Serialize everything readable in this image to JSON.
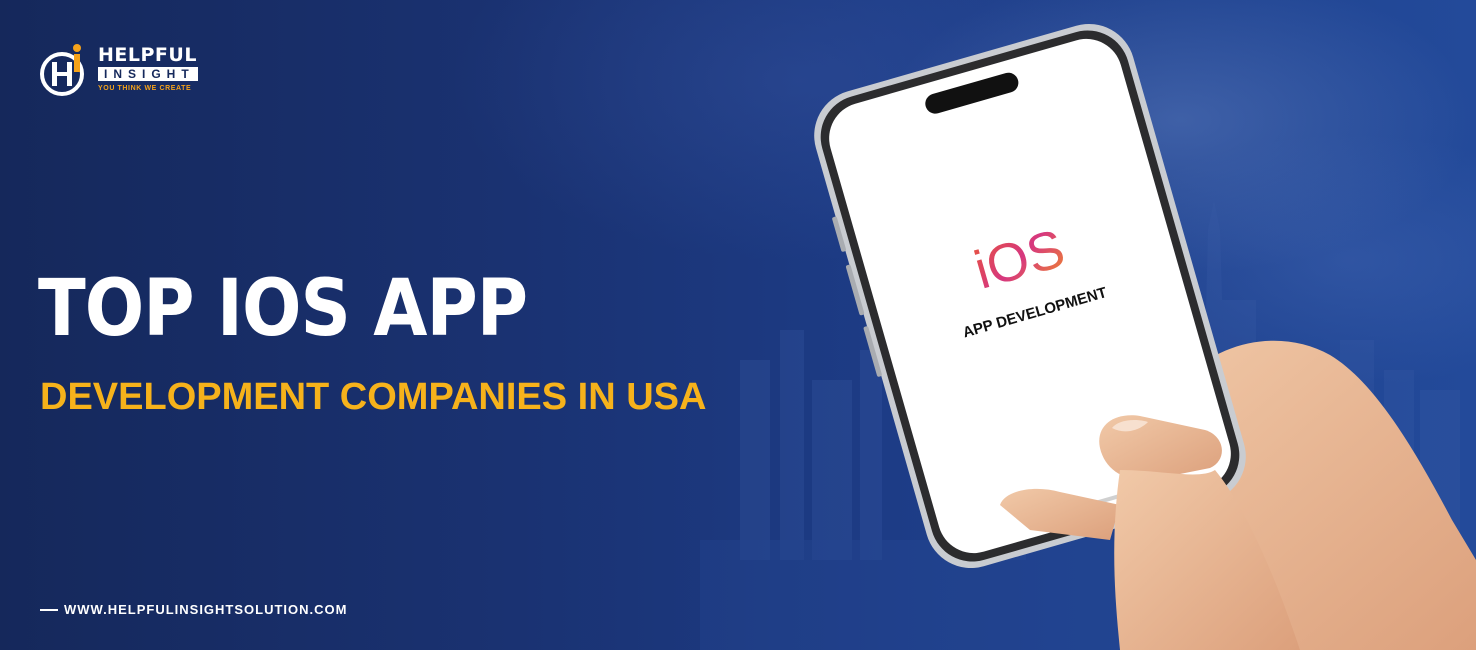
{
  "brand": {
    "name_line1": "HELPFUL",
    "name_line2": "INSIGHT",
    "tagline": "YOU THINK WE CREATE"
  },
  "headline": "TOP IOS APP",
  "subheadline": "DEVELOPMENT COMPANIES IN USA",
  "website": "WWW.HELPFULINSIGHTSOLUTION.COM",
  "phone_screen": {
    "logo_text": "iOS",
    "caption": "APP DEVELOPMENT"
  },
  "colors": {
    "background": "#1a3272",
    "accent": "#f6b21b",
    "text": "#ffffff"
  }
}
